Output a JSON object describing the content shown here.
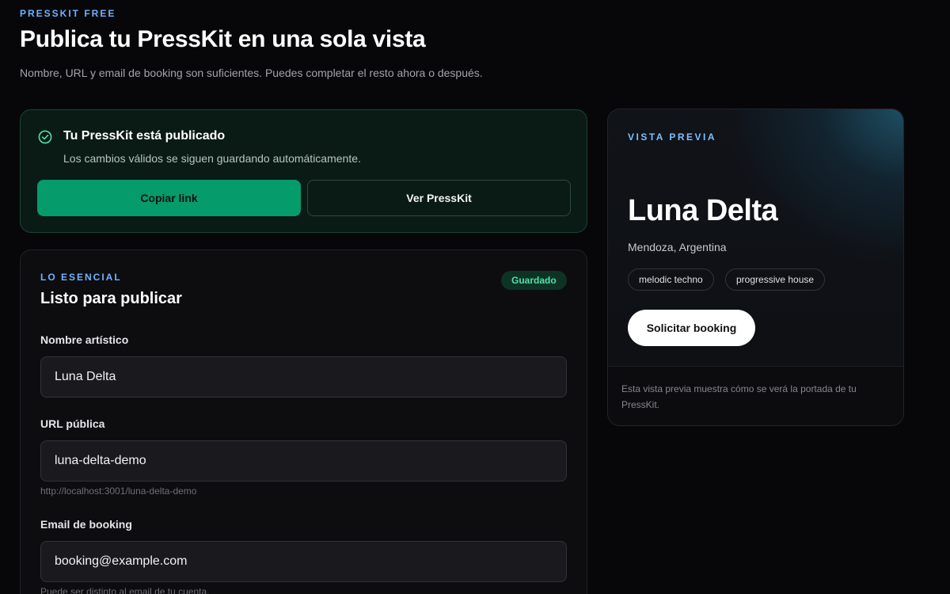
{
  "header": {
    "eyebrow": "PRESSKIT FREE",
    "title": "Publica tu PressKit en una sola vista",
    "subtitle": "Nombre, URL y email de booking son suficientes. Puedes completar el resto ahora o después."
  },
  "published": {
    "title": "Tu PressKit está publicado",
    "description": "Los cambios válidos se siguen guardando automáticamente.",
    "copy_label": "Copiar link",
    "view_label": "Ver PressKit",
    "icon": "check-circle-icon"
  },
  "essentials": {
    "eyebrow": "LO ESENCIAL",
    "title": "Listo para publicar",
    "badge": "Guardado",
    "fields": {
      "name": {
        "label": "Nombre artístico",
        "value": "Luna Delta"
      },
      "url": {
        "label": "URL pública",
        "value": "luna-delta-demo",
        "hint": "http://localhost:3001/luna-delta-demo"
      },
      "email": {
        "label": "Email de booking",
        "value": "booking@example.com",
        "hint": "Puede ser distinto al email de tu cuenta."
      }
    }
  },
  "preview": {
    "eyebrow": "VISTA PREVIA",
    "name": "Luna Delta",
    "location": "Mendoza, Argentina",
    "genres": [
      "melodic techno",
      "progressive house"
    ],
    "booking_label": "Solicitar booking",
    "footer": "Esta vista previa muestra cómo se verá la portada de tu PressKit."
  },
  "colors": {
    "accent": "#6fb3ff",
    "success": "#069b6b",
    "saved_text": "#4fe0a7",
    "background": "#070709"
  }
}
